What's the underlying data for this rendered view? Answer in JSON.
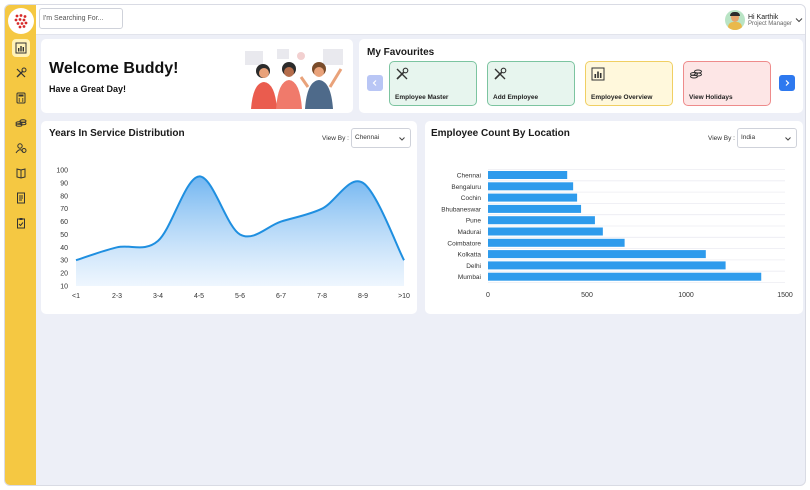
{
  "topbar": {
    "search_placeholder": "I'm Searching For...",
    "user_greeting": "Hi Karthik",
    "user_role": "Project Manager"
  },
  "sidebar": {
    "icons": [
      "chart-icon",
      "tools-icon",
      "calculator-icon",
      "coins-icon",
      "people-icon",
      "book-icon",
      "document-icon",
      "clipboard-check-icon"
    ]
  },
  "welcome": {
    "title": "Welcome Buddy!",
    "subtitle": "Have a Great Day!"
  },
  "favourites": {
    "title": "My Favourites",
    "items": [
      {
        "label": "Employee Master",
        "icon": "tools-icon",
        "bg": "#e7f5ee",
        "border": "#7cc4a0"
      },
      {
        "label": "Add Employee",
        "icon": "tools-icon",
        "bg": "#e7f5ee",
        "border": "#7cc4a0"
      },
      {
        "label": "Employee Overview",
        "icon": "chart-icon",
        "bg": "#fff8dc",
        "border": "#f0cf63"
      },
      {
        "label": "View Holidays",
        "icon": "coins-icon",
        "bg": "#fde6e6",
        "border": "#ee8b8b"
      }
    ]
  },
  "colors": {
    "sidebar": "#f5c842",
    "accent_blue": "#2e79ef",
    "line": "#1f8fe0",
    "bar": "#2e9bec"
  },
  "service_chart": {
    "viewby_label": "View By :",
    "selected": "Chennai"
  },
  "location_chart": {
    "viewby_label": "View By :",
    "selected": "India"
  },
  "chart_data": [
    {
      "type": "area",
      "title": "Years In Service Distribution",
      "categories": [
        "<1",
        "2-3",
        "3-4",
        "4-5",
        "5-6",
        "6-7",
        "7-8",
        "8-9",
        ">10"
      ],
      "values": [
        30,
        40,
        45,
        95,
        50,
        60,
        70,
        90,
        30
      ],
      "ylim": [
        10,
        100
      ],
      "yticks": [
        10,
        20,
        30,
        40,
        50,
        60,
        70,
        80,
        90,
        100
      ],
      "grid": false
    },
    {
      "type": "bar",
      "orientation": "horizontal",
      "title": "Employee Count By Location",
      "categories": [
        "Chennai",
        "Bengaluru",
        "Cochin",
        "Bhubaneswar",
        "Pune",
        "Madurai",
        "Coimbatore",
        "Kolkatta",
        "Delhi",
        "Mumbai"
      ],
      "values": [
        400,
        430,
        450,
        470,
        540,
        580,
        690,
        1100,
        1200,
        1380
      ],
      "xlim": [
        0,
        1500
      ],
      "xticks": [
        0,
        500,
        1000,
        1500
      ],
      "grid": true
    }
  ]
}
